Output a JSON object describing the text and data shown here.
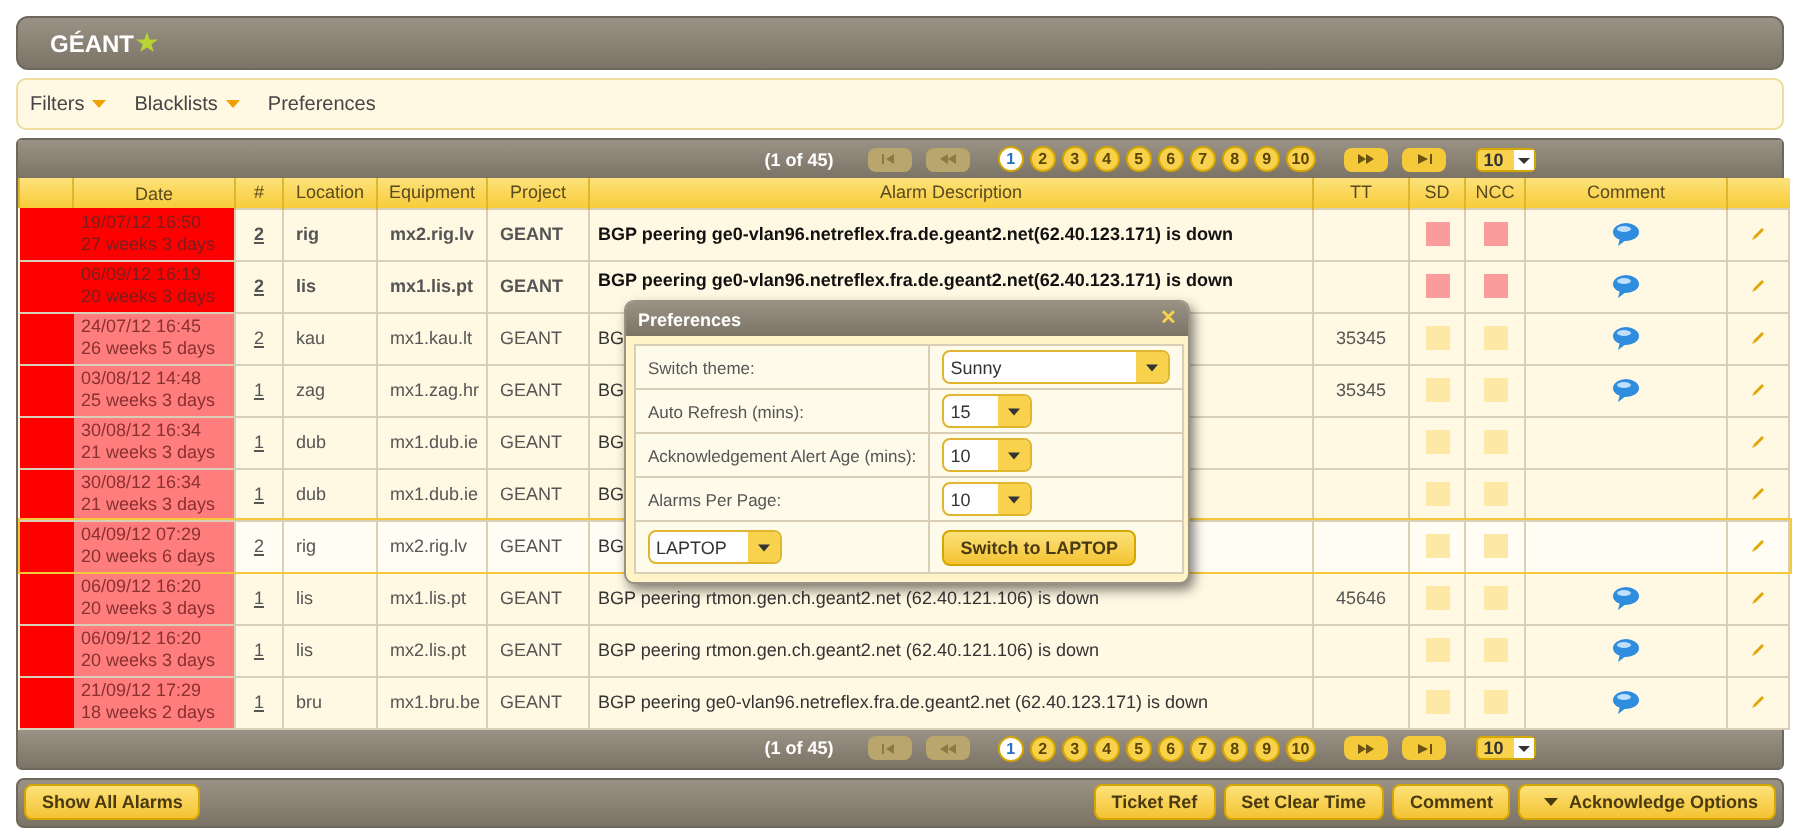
{
  "header": {
    "logo": "GÉANT"
  },
  "menu": [
    {
      "label": "Filters",
      "dropdown": true
    },
    {
      "label": "Blacklists",
      "dropdown": true
    },
    {
      "label": "Preferences",
      "dropdown": false
    }
  ],
  "pager_top": {
    "summary": "(1 of 45)",
    "pages": [
      {
        "label": "1",
        "selected": true
      },
      {
        "label": "2",
        "selected": false
      },
      {
        "label": "3",
        "selected": false
      },
      {
        "label": "4",
        "selected": false
      },
      {
        "label": "5",
        "selected": false
      },
      {
        "label": "6",
        "selected": false
      },
      {
        "label": "7",
        "selected": false
      },
      {
        "label": "8",
        "selected": false
      },
      {
        "label": "9",
        "selected": false
      },
      {
        "label": "10",
        "selected": false
      }
    ],
    "per_page": "10"
  },
  "table": {
    "columns": [
      "Date",
      "#",
      "Location",
      "Equipment",
      "Project",
      "Alarm Description",
      "TT",
      "SD",
      "NCC",
      "Comment"
    ],
    "rows": [
      {
        "date": "19/07/12 16:50",
        "age": "27 weeks 3 days",
        "count": "2",
        "location": "rig",
        "equipment": "mx2.rig.lv",
        "project": "GEANT",
        "description": "BGP peering ge0-vlan96.netreflex.fra.de.geant2.net(62.40.123.171) is down",
        "tt": "",
        "critical": true,
        "sd": true,
        "ncc": true,
        "comment": true,
        "selected": false
      },
      {
        "date": "06/09/12 16:19",
        "age": "20 weeks 3 days",
        "count": "2",
        "location": "lis",
        "equipment": "mx1.lis.pt",
        "project": "GEANT",
        "description": "BGP peering ge0-vlan96.netreflex.fra.de.geant2.net(62.40.123.171) is down",
        "tt": "",
        "critical": true,
        "sd": true,
        "ncc": true,
        "comment": true,
        "selected": false
      },
      {
        "date": "24/07/12 16:45",
        "age": "26 weeks 5 days",
        "count": "2",
        "location": "kau",
        "equipment": "mx1.kau.lt",
        "project": "GEANT",
        "description": "BG",
        "tt": "35345",
        "critical": false,
        "sd": false,
        "ncc": false,
        "comment": true,
        "selected": false
      },
      {
        "date": "03/08/12 14:48",
        "age": "25 weeks 3 days",
        "count": "1",
        "location": "zag",
        "equipment": "mx1.zag.hr",
        "project": "GEANT",
        "description": "BG",
        "tt": "35345",
        "critical": false,
        "sd": false,
        "ncc": false,
        "comment": true,
        "selected": false
      },
      {
        "date": "30/08/12 16:34",
        "age": "21 weeks 3 days",
        "count": "1",
        "location": "dub",
        "equipment": "mx1.dub.ie",
        "project": "GEANT",
        "description": "BG",
        "tt": "",
        "critical": false,
        "sd": false,
        "ncc": false,
        "comment": false,
        "selected": false
      },
      {
        "date": "30/08/12 16:34",
        "age": "21 weeks 3 days",
        "count": "1",
        "location": "dub",
        "equipment": "mx1.dub.ie",
        "project": "GEANT",
        "description": "BG",
        "tt": "",
        "critical": false,
        "sd": false,
        "ncc": false,
        "comment": false,
        "selected": false
      },
      {
        "date": "04/09/12 07:29",
        "age": "20 weeks 6 days",
        "count": "2",
        "location": "rig",
        "equipment": "mx2.rig.lv",
        "project": "GEANT",
        "description": "BG",
        "tt": "",
        "critical": false,
        "sd": false,
        "ncc": false,
        "comment": false,
        "selected": true
      },
      {
        "date": "06/09/12 16:20",
        "age": "20 weeks 3 days",
        "count": "1",
        "location": "lis",
        "equipment": "mx1.lis.pt",
        "project": "GEANT",
        "description": "BGP peering rtmon.gen.ch.geant2.net (62.40.121.106) is down",
        "tt": "45646",
        "critical": false,
        "sd": false,
        "ncc": false,
        "comment": true,
        "selected": false
      },
      {
        "date": "06/09/12 16:20",
        "age": "20 weeks 3 days",
        "count": "1",
        "location": "lis",
        "equipment": "mx2.lis.pt",
        "project": "GEANT",
        "description": "BGP peering rtmon.gen.ch.geant2.net (62.40.121.106) is down",
        "tt": "",
        "critical": false,
        "sd": false,
        "ncc": false,
        "comment": true,
        "selected": false
      },
      {
        "date": "21/09/12 17:29",
        "age": "18 weeks 2 days",
        "count": "1",
        "location": "bru",
        "equipment": "mx1.bru.be",
        "project": "GEANT",
        "description": "BGP peering ge0-vlan96.netreflex.fra.de.geant2.net (62.40.123.171) is down",
        "tt": "",
        "critical": false,
        "sd": false,
        "ncc": false,
        "comment": true,
        "selected": false
      }
    ]
  },
  "pager_bottom": {
    "summary": "(1 of 45)",
    "pages": [
      {
        "label": "1",
        "selected": true
      },
      {
        "label": "2",
        "selected": false
      },
      {
        "label": "3",
        "selected": false
      },
      {
        "label": "4",
        "selected": false
      },
      {
        "label": "5",
        "selected": false
      },
      {
        "label": "6",
        "selected": false
      },
      {
        "label": "7",
        "selected": false
      },
      {
        "label": "8",
        "selected": false
      },
      {
        "label": "9",
        "selected": false
      },
      {
        "label": "10",
        "selected": false
      }
    ],
    "per_page": "10"
  },
  "footer": {
    "left_buttons": [
      {
        "label": "Show All Alarms",
        "dropdown": false
      }
    ],
    "right_buttons": [
      {
        "label": "Ticket Ref",
        "dropdown": false
      },
      {
        "label": "Set Clear Time",
        "dropdown": false
      },
      {
        "label": "Comment",
        "dropdown": false
      },
      {
        "label": "Acknowledge Options",
        "dropdown": true
      }
    ]
  },
  "dialog": {
    "title": "Preferences",
    "close": "✕",
    "fields": [
      {
        "label": "Switch theme:",
        "value": "Sunny",
        "kind": "wide"
      },
      {
        "label": "Auto Refresh (mins):",
        "value": "15",
        "kind": "narrow"
      },
      {
        "label": "Acknowledgement Alert Age (mins):",
        "value": "10",
        "kind": "narrow"
      },
      {
        "label": "Alarms Per Page:",
        "value": "10",
        "kind": "narrow"
      }
    ],
    "mode": {
      "value": "LAPTOP",
      "button": "Switch to LAPTOP"
    }
  }
}
